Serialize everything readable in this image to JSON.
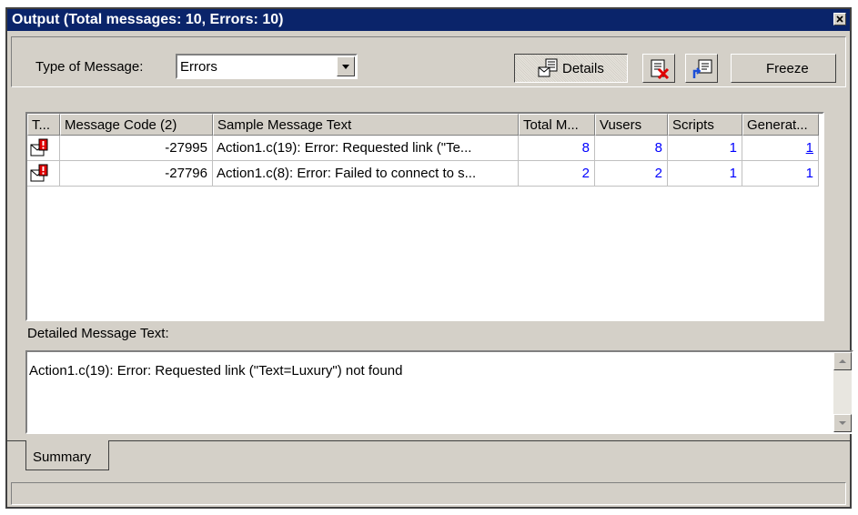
{
  "window": {
    "title": "Output (Total messages: 10,  Errors: 10)"
  },
  "toolbar": {
    "type_label": "Type of Message:",
    "type_value": "Errors",
    "details_label": "Details",
    "freeze_label": "Freeze"
  },
  "grid": {
    "columns": [
      "T...",
      "Message Code (2)",
      "Sample Message Text",
      "Total M...",
      "Vusers",
      "Scripts",
      "Generat..."
    ],
    "rows": [
      {
        "code": "-27995",
        "text": "Action1.c(19): Error: Requested link (\"Te...",
        "total": "8",
        "vusers": "8",
        "scripts": "1",
        "generators": "1"
      },
      {
        "code": "-27796",
        "text": "Action1.c(8): Error: Failed to connect to s...",
        "total": "2",
        "vusers": "2",
        "scripts": "1",
        "generators": "1"
      }
    ]
  },
  "details": {
    "label": "Detailed Message Text:",
    "text": "Action1.c(19): Error: Requested link (\"Text=Luxury\") not found"
  },
  "tabs": {
    "summary": "Summary"
  },
  "icons": {
    "message_type": "error-message-icon",
    "clear": "clear-messages-icon",
    "export": "export-icon",
    "details": "details-icon",
    "close": "close-icon"
  },
  "colors": {
    "titlebar": "#0a246a",
    "link": "#0000ff",
    "error_badge": "#e00000"
  }
}
